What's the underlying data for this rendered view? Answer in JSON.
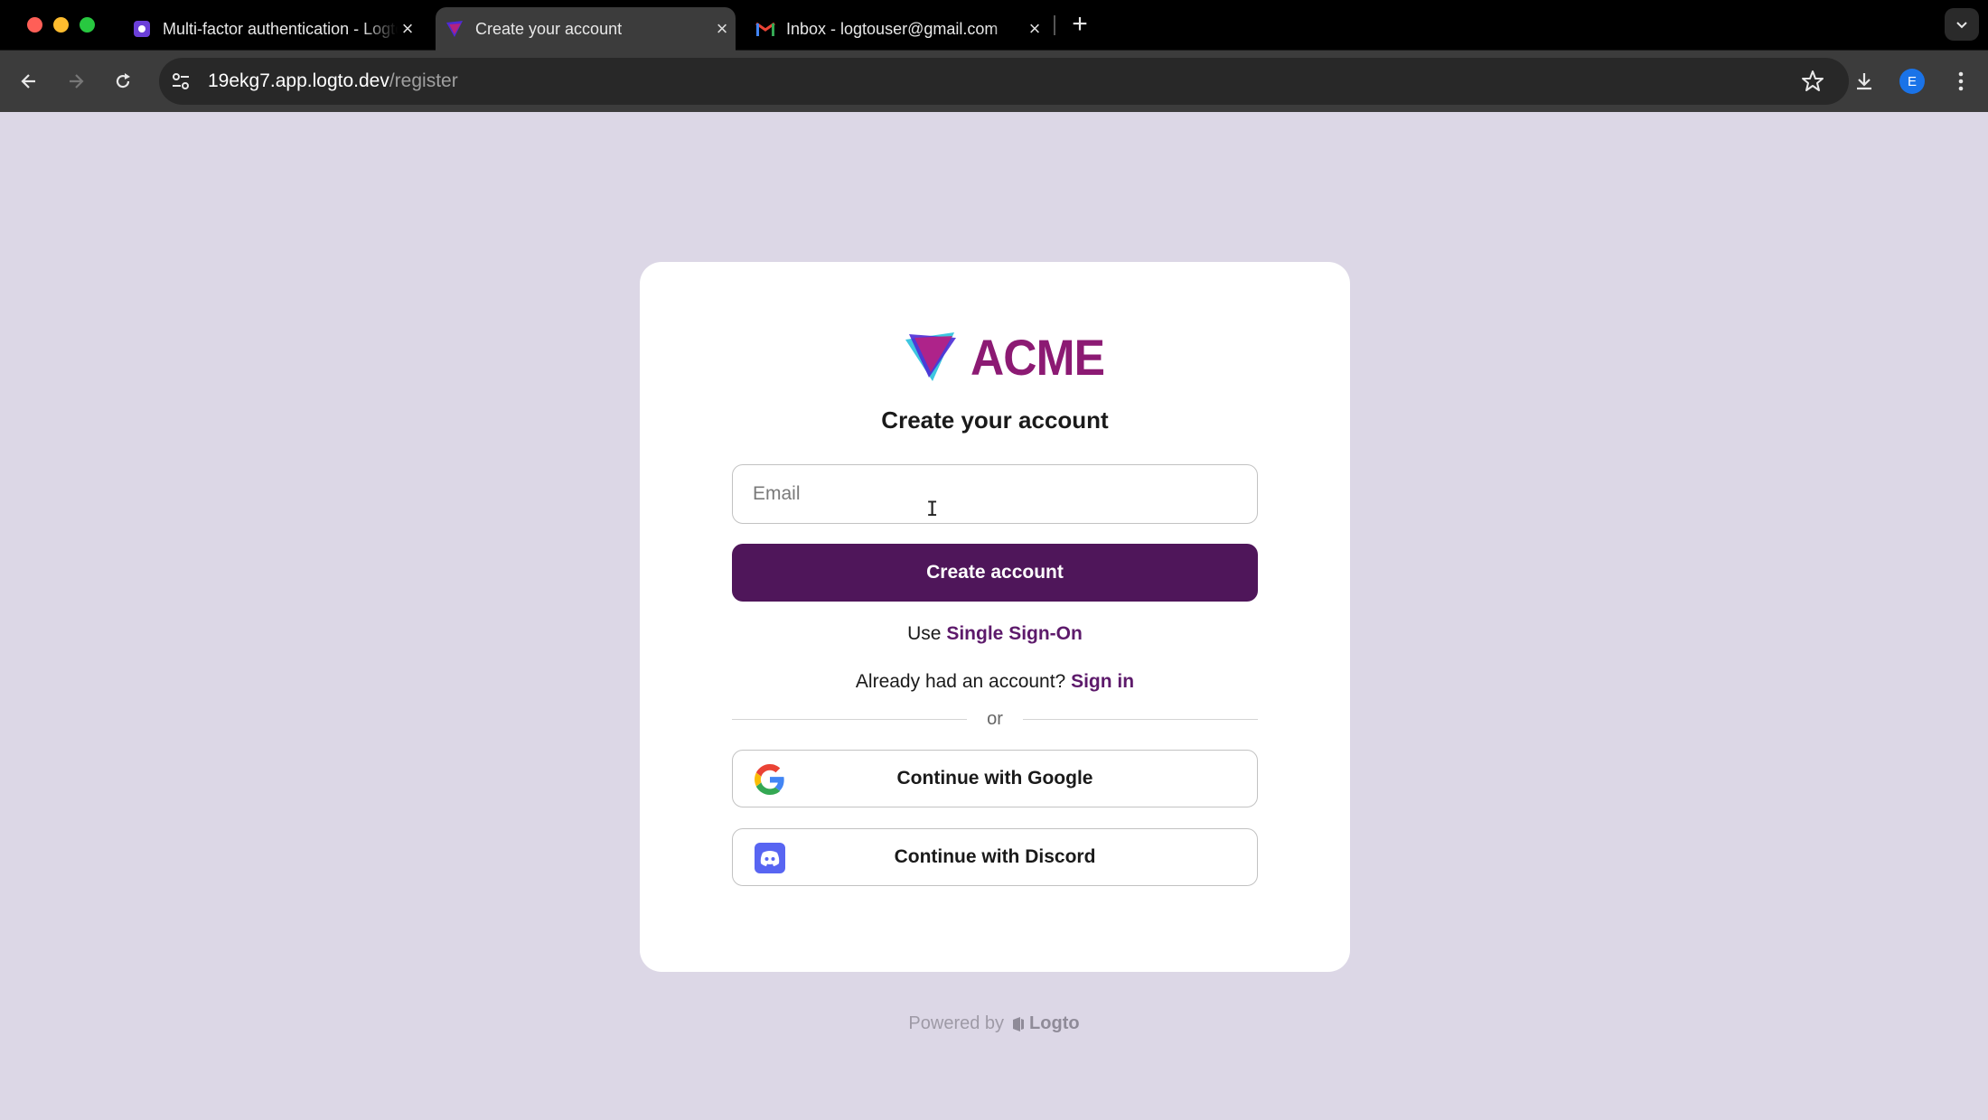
{
  "browser": {
    "tabs": [
      {
        "title": "Multi-factor authentication - Logto",
        "icon": "logto-docs-icon",
        "active": false
      },
      {
        "title": "Create your account",
        "icon": "acme-icon",
        "active": true
      },
      {
        "title": "Inbox - logtouser@gmail.com",
        "icon": "gmail-icon",
        "active": false
      }
    ],
    "new_tab_label": "+",
    "url_host": "19ekg7.app.logto.dev",
    "url_path": "/register",
    "profile_initial": "E"
  },
  "card": {
    "brand_name": "ACME",
    "title": "Create your account",
    "email_placeholder": "Email",
    "email_value": "",
    "create_button": "Create account",
    "sso_prefix": "Use",
    "sso_link": "Single Sign-On",
    "signin_prefix": "Already had an account?",
    "signin_link": "Sign in",
    "divider_text": "or",
    "google_button": "Continue with Google",
    "discord_button": "Continue with Discord"
  },
  "footer": {
    "powered_by": "Powered by",
    "brand": "Logto"
  },
  "colors": {
    "page_bg": "#dcd7e6",
    "primary": "#4f165a",
    "brand": "#8c1a73",
    "link": "#5d1a6b",
    "discord": "#5865f2"
  }
}
